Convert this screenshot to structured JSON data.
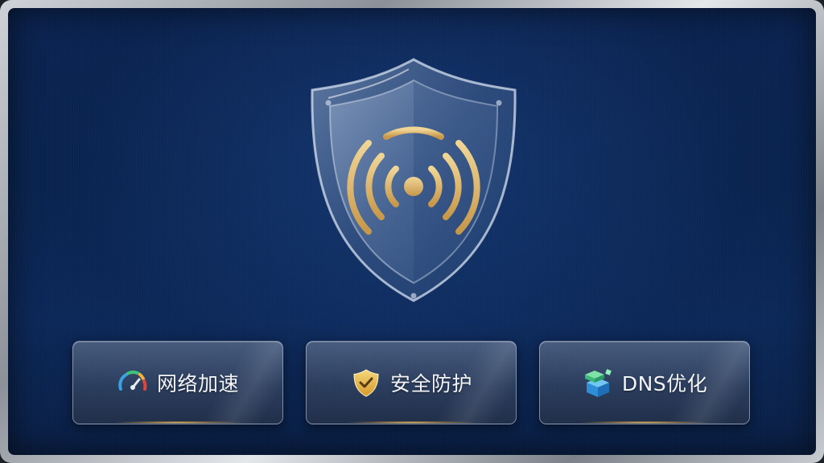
{
  "screen": {
    "hero_icon": "shield-wifi-icon"
  },
  "actions": [
    {
      "label": "网络加速",
      "icon": "speedometer-icon"
    },
    {
      "label": "安全防护",
      "icon": "shield-check-icon"
    },
    {
      "label": "DNS优化",
      "icon": "cube-blocks-icon"
    }
  ],
  "colors": {
    "background": "#0b2350",
    "accent_gold": "#d9b36a",
    "text": "#f2f4f7"
  }
}
